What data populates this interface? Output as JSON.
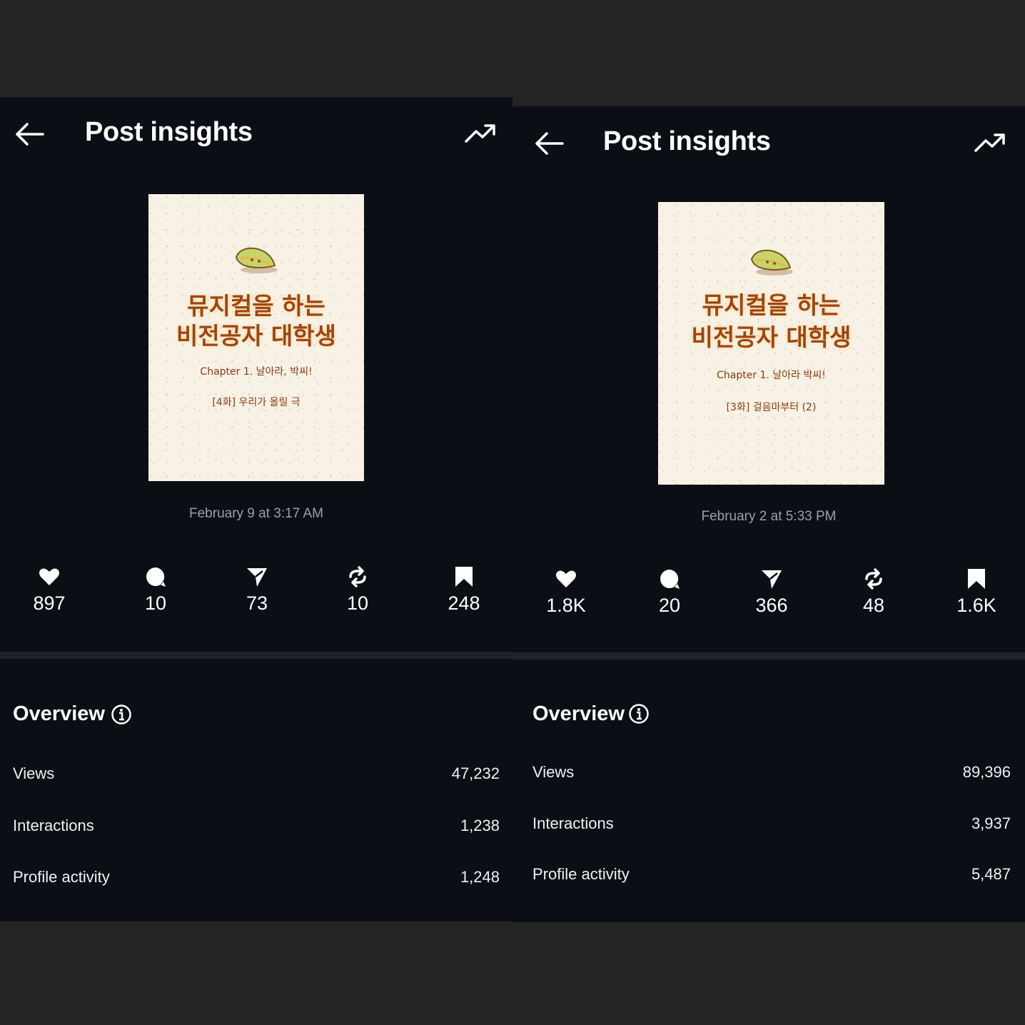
{
  "panels": [
    {
      "header": {
        "title": "Post insights",
        "back_icon": "arrow-left-icon",
        "trend_icon": "trending-up-icon"
      },
      "thumbnail": {
        "title_line1": "뮤지컬을 하는",
        "title_line2": "비전공자 대학생",
        "chapter": "Chapter 1. 날아라, 박씨!",
        "episode": "[4화] 우리가 올릴 극"
      },
      "date": "February 9 at 3:17 AM",
      "stats": {
        "likes": "897",
        "comments": "10",
        "shares": "73",
        "reposts": "10",
        "saves": "248"
      },
      "overview": {
        "title": "Overview",
        "metrics": [
          {
            "label": "Views",
            "value": "47,232"
          },
          {
            "label": "Interactions",
            "value": "1,238"
          },
          {
            "label": "Profile activity",
            "value": "1,248"
          }
        ]
      }
    },
    {
      "header": {
        "title": "Post insights",
        "back_icon": "arrow-left-icon",
        "trend_icon": "trending-up-icon"
      },
      "thumbnail": {
        "title_line1": "뮤지컬을 하는",
        "title_line2": "비전공자 대학생",
        "chapter": "Chapter 1. 날아라 박씨!",
        "episode": "[3화] 걸음마부터 (2)"
      },
      "date": "February 2 at 5:33 PM",
      "stats": {
        "likes": "1.8K",
        "comments": "20",
        "shares": "366",
        "reposts": "48",
        "saves": "1.6K"
      },
      "overview": {
        "title": "Overview",
        "metrics": [
          {
            "label": "Views",
            "value": "89,396"
          },
          {
            "label": "Interactions",
            "value": "3,937"
          },
          {
            "label": "Profile activity",
            "value": "5,487"
          }
        ]
      }
    }
  ],
  "colors": {
    "panel_bg": "#0b0f15",
    "page_bg": "#242424",
    "divider": "#1e232b",
    "muted_text": "#9aa0a8"
  }
}
